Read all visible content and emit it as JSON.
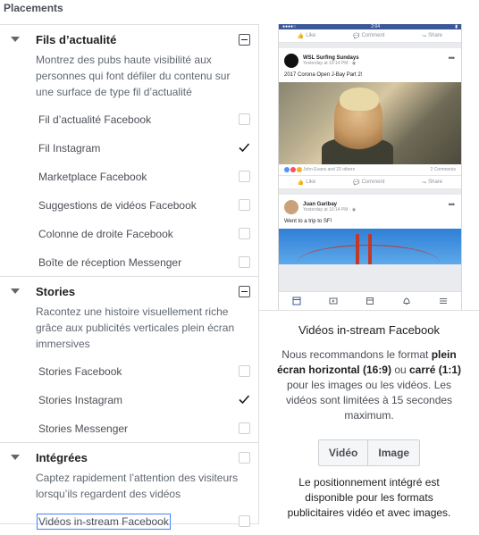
{
  "header": {
    "title": "Placements"
  },
  "sections": [
    {
      "title": "Fils d’actualité",
      "state": "minus",
      "description": "Montrez des pubs haute visibilité aux personnes qui font défiler du contenu sur une surface de type fil d’actualité",
      "items": [
        {
          "label": "Fil d’actualité Facebook",
          "checked": false
        },
        {
          "label": "Fil Instagram",
          "checked": true
        },
        {
          "label": "Marketplace Facebook",
          "checked": false
        },
        {
          "label": "Suggestions de vidéos Facebook",
          "checked": false
        },
        {
          "label": "Colonne de droite Facebook",
          "checked": false
        },
        {
          "label": "Boîte de réception Messenger",
          "checked": false
        }
      ]
    },
    {
      "title": "Stories",
      "state": "minus",
      "description": "Racontez une histoire visuellement riche grâce aux publicités verticales plein écran immersives",
      "items": [
        {
          "label": "Stories Facebook",
          "checked": false
        },
        {
          "label": "Stories Instagram",
          "checked": true
        },
        {
          "label": "Stories Messenger",
          "checked": false
        }
      ]
    },
    {
      "title": "Intégrées",
      "state": "empty",
      "description": "Captez rapidement l’attention des visiteurs lorsqu’ils regardent des vidéos",
      "items": [
        {
          "label": "Vidéos in-stream Facebook",
          "checked": false,
          "focused": true
        }
      ]
    }
  ],
  "preview": {
    "status_time": "2:04",
    "top_actions": [
      "Like",
      "Comment",
      "Share"
    ],
    "post1": {
      "name": "WSL Surfing Sundays",
      "time": "Yesterday at 10:14 PM · ",
      "text": "2017 Corona Open J-Bay Part 2!",
      "reactions": "John Evans and 23 others",
      "comments": "2 Comments",
      "actions": [
        "Like",
        "Comment",
        "Share"
      ]
    },
    "post2": {
      "name": "Juan Garibay",
      "time": "Yesterday at 10:14 PM · ",
      "text": "Went to a trip to SF!"
    },
    "tab_icons": [
      "news-feed-icon",
      "video-icon",
      "marketplace-icon",
      "notifications-icon",
      "menu-icon"
    ]
  },
  "info": {
    "title": "Vidéos in-stream Facebook",
    "body_pre": "Nous recommandons le format ",
    "body_b1": "plein écran horizontal (16:9)",
    "body_mid": " ou ",
    "body_b2": "carré (1:1)",
    "body_post": " pour les images ou les vidéos. Les vidéos sont limitées à 15 secondes maximum.",
    "btn_video": "Vidéo",
    "btn_image": "Image",
    "note": "Le positionnement intégré est disponible pour les formats publicitaires vidéo et avec images."
  },
  "colors": {
    "accent": "#4080ff",
    "facebook_blue": "#3b5998"
  }
}
